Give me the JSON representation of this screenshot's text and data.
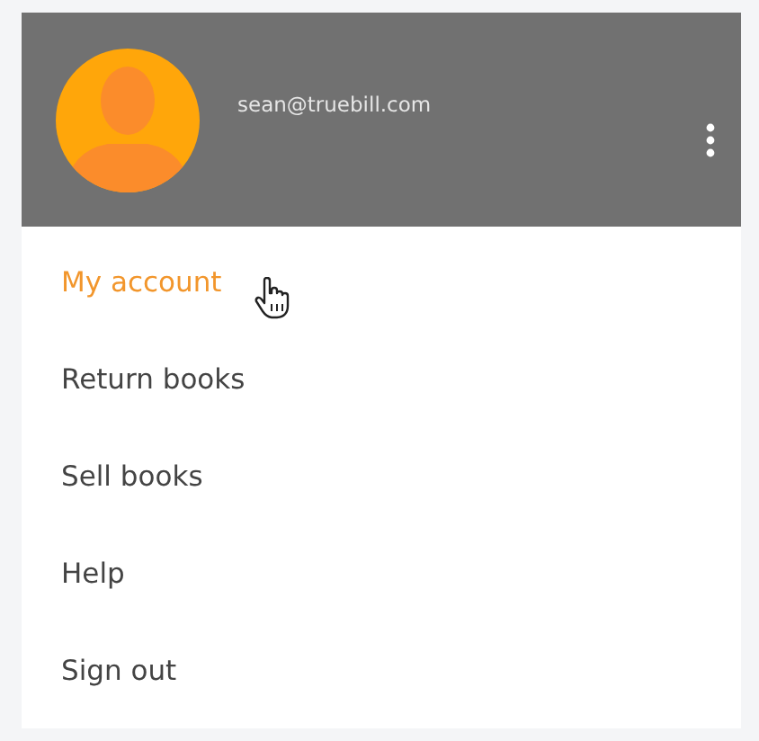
{
  "header": {
    "email": "sean@truebill.com"
  },
  "menu": [
    {
      "label": "My account",
      "selected": true
    },
    {
      "label": "Return books",
      "selected": false
    },
    {
      "label": "Sell books",
      "selected": false
    },
    {
      "label": "Help",
      "selected": false
    },
    {
      "label": "Sign out",
      "selected": false
    }
  ]
}
